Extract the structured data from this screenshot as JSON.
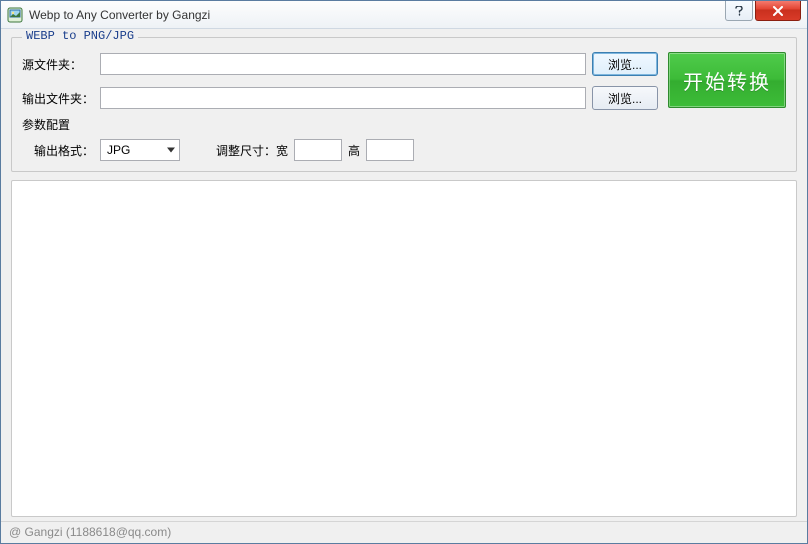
{
  "window": {
    "title": "Webp to Any Converter by Gangzi"
  },
  "group": {
    "legend": "WEBP to PNG/JPG",
    "source_label": "源文件夹：",
    "source_value": "",
    "output_label": "输出文件夹：",
    "output_value": "",
    "browse_label": "浏览...",
    "start_label": "开始转换"
  },
  "params": {
    "title": "参数配置",
    "format_label": "输出格式：",
    "format_value": "JPG",
    "resize_label": "调整尺寸：宽",
    "width_value": "",
    "height_label": "高",
    "height_value": ""
  },
  "status": {
    "text": "@ Gangzi (1188618@qq.com)"
  }
}
